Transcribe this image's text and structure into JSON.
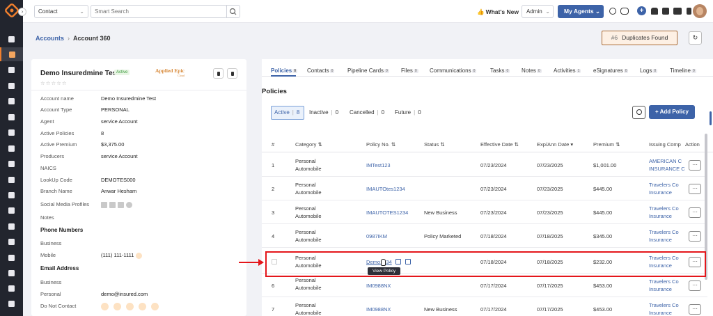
{
  "topbar": {
    "search_type": "Contact",
    "search_placeholder": "Smart Search",
    "whats_new": "What's New",
    "role": "Admin",
    "my_agents": "My Agents"
  },
  "breadcrumb": {
    "parent": "Accounts",
    "current": "Account 360"
  },
  "duplicates": {
    "count": "#6",
    "label": "Duplicates Found"
  },
  "account": {
    "name": "Demo Insuredmine Test",
    "status": "Active",
    "stars": "☆☆☆☆☆",
    "integration_logo": "Applied Epic",
    "integration_logo_sub": "Cloud",
    "fields": [
      {
        "label": "Account name",
        "value": "Demo Insuredmine Test"
      },
      {
        "label": "Account Type",
        "value": "PERSONAL"
      },
      {
        "label": "Agent",
        "value": "service Account"
      },
      {
        "label": "Active Policies",
        "value": "8"
      },
      {
        "label": "Active Premium",
        "value": "$3,375.00"
      },
      {
        "label": "Producers",
        "value": "service Account"
      },
      {
        "label": "NAICS",
        "value": ""
      },
      {
        "label": "LookUp Code",
        "value": "DEMOTES000"
      },
      {
        "label": "Branch Name",
        "value": "Anwar Hesham"
      },
      {
        "label": "Social Media Profiles",
        "value": ""
      },
      {
        "label": "Notes",
        "value": ""
      }
    ],
    "phone_section": "Phone Numbers",
    "phone_fields": [
      {
        "label": "Business",
        "value": ""
      },
      {
        "label": "Mobile",
        "value": "(111) 111-1111"
      }
    ],
    "email_section": "Email Address",
    "email_fields": [
      {
        "label": "Business",
        "value": ""
      },
      {
        "label": "Personal",
        "value": "demo@insured.com"
      }
    ],
    "do_not_contact": "Do Not Contact"
  },
  "tabs": [
    {
      "label": "Policies",
      "count": "8"
    },
    {
      "label": "Contacts",
      "count": "0"
    },
    {
      "label": "Pipeline Cards",
      "count": "0"
    },
    {
      "label": "Files",
      "count": "0"
    },
    {
      "label": "Communications",
      "count": "0"
    },
    {
      "label": "Tasks",
      "count": "0"
    },
    {
      "label": "Notes",
      "count": "0"
    },
    {
      "label": "Activities",
      "count": "1"
    },
    {
      "label": "eSignatures",
      "count": "0"
    },
    {
      "label": "Logs",
      "count": "0"
    },
    {
      "label": "Timeline",
      "count": "0"
    }
  ],
  "section_title": "Policies",
  "filters": {
    "active_label": "Active",
    "active_count": "8",
    "inactive_label": "Inactive",
    "inactive_count": "0",
    "cancelled_label": "Cancelled",
    "cancelled_count": "0",
    "future_label": "Future",
    "future_count": "0"
  },
  "add_policy": "+ Add Policy",
  "columns": [
    "#",
    "Category",
    "Policy No.",
    "Status",
    "Effective Date",
    "Exp/Ann Date",
    "Premium",
    "Issuing Comp",
    "Action"
  ],
  "rows": [
    {
      "num": "1",
      "cat1": "Personal",
      "cat2": "Automobile",
      "policy": "IMTest123",
      "status": "",
      "eff": "07/23/2024",
      "exp": "07/23/2025",
      "premium": "$1,001.00",
      "ic1": "AMERICAN C",
      "ic2": "INSURANCE C"
    },
    {
      "num": "2",
      "cat1": "Personal",
      "cat2": "Automobile",
      "policy": "IMAUTOtes1234",
      "status": "",
      "eff": "07/23/2024",
      "exp": "07/23/2025",
      "premium": "$445.00",
      "ic1": "Travelers Co",
      "ic2": "Insurance"
    },
    {
      "num": "3",
      "cat1": "Personal",
      "cat2": "Automobile",
      "policy": "IMAUTOTES1234",
      "status": "New Business",
      "eff": "07/23/2024",
      "exp": "07/23/2025",
      "premium": "$445.00",
      "ic1": "Travelers Co",
      "ic2": "Insurance"
    },
    {
      "num": "4",
      "cat1": "Personal",
      "cat2": "Automobile",
      "policy": "0987IKM",
      "status": "Policy Marketed",
      "eff": "07/18/2024",
      "exp": "07/18/2025",
      "premium": "$345.00",
      "ic1": "Travelers Co",
      "ic2": "Insurance"
    },
    {
      "num": "",
      "cat1": "Personal",
      "cat2": "Automobile",
      "policy": "Demo1234",
      "status": "",
      "eff": "07/18/2024",
      "exp": "07/18/2025",
      "premium": "$232.00",
      "ic1": "Travelers Co",
      "ic2": "Insurance"
    },
    {
      "num": "6",
      "cat1": "Personal",
      "cat2": "Automobile",
      "policy": "IM0988NX",
      "status": "",
      "eff": "07/17/2024",
      "exp": "07/17/2025",
      "premium": "$453.00",
      "ic1": "Travelers Co",
      "ic2": "Insurance"
    },
    {
      "num": "7",
      "cat1": "Personal",
      "cat2": "Automobile",
      "policy": "IM0988NX",
      "status": "New Business",
      "eff": "07/17/2024",
      "exp": "07/17/2025",
      "premium": "$453.00",
      "ic1": "Travelers Co",
      "ic2": "Insurance"
    }
  ],
  "action_label": "···",
  "tooltip": "View Policy",
  "colors": {
    "accent": "#3d63a8",
    "sidebar": "#22252e",
    "brand_orange": "#f07f2d",
    "highlight": "#e4161b"
  }
}
